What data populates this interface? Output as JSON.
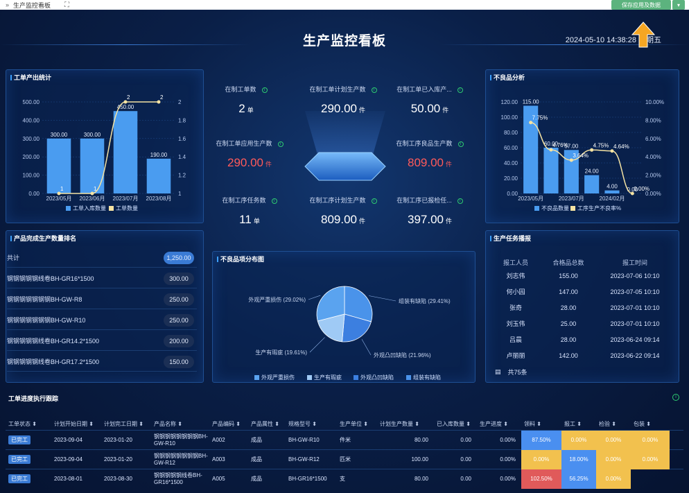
{
  "topbar": {
    "breadcrumb_sep": "»",
    "breadcrumb_title": "生产监控看板",
    "fullscreen_glyph": "⛶",
    "save_label": "保存应用及数据",
    "dropdown_glyph": "▾"
  },
  "header": {
    "title": "生产监控看板",
    "datetime": "2024-05-10 14:38:28 星期五"
  },
  "colors": {
    "bar": "#4a9cf0",
    "line": "#f5e3a3",
    "red": "#ff5a5a",
    "accent": "#3a7bd5"
  },
  "panels": {
    "workorder_output": "工单产出统计",
    "defect_analysis": "不良品分析",
    "product_rank": "产品完成生产数量排名",
    "defect_dist": "不良品项分布图",
    "task_ranking": "生产任务播报",
    "workorder_progress": "工单进度执行跟踪"
  },
  "kpis": [
    {
      "label": "在制工单数",
      "value": "2",
      "unit": "单",
      "red": false
    },
    {
      "label": "在制工单计划生产数",
      "value": "290.00",
      "unit": "件",
      "red": false
    },
    {
      "label": "在制工单已入库产...",
      "value": "50.00",
      "unit": "件",
      "red": false
    },
    {
      "label": "在制工单应用生产数",
      "value": "290.00",
      "unit": "件",
      "red": true
    },
    {
      "label": "在制工序良品生产数",
      "value": "809.00",
      "unit": "件",
      "red": true
    },
    {
      "label": "在制工序任务数",
      "value": "11",
      "unit": "单",
      "red": false
    },
    {
      "label": "在制工序计划生产数",
      "value": "809.00",
      "unit": "件",
      "red": false
    },
    {
      "label": "在制工序已报检任...",
      "value": "397.00",
      "unit": "件",
      "red": false
    }
  ],
  "chart_data": [
    {
      "type": "bar",
      "title": "工单产出统计",
      "categories": [
        "2023/05月",
        "2023/06月",
        "2023/07月",
        "2023/08月"
      ],
      "series": [
        {
          "name": "工单入库数量",
          "values": [
            300,
            300,
            450,
            190
          ]
        },
        {
          "name": "工单数量",
          "values": [
            1,
            1,
            2,
            2
          ]
        }
      ],
      "bar_labels": [
        "300.00",
        "300.00",
        "450.00",
        "190.00"
      ],
      "line_labels": [
        "1",
        "1",
        "2",
        "2"
      ],
      "ylim": [
        0,
        500
      ],
      "y2lim": [
        1,
        2
      ],
      "yticks": [
        "0.00",
        "100.00",
        "200.00",
        "300.00",
        "400.00",
        "500.00"
      ],
      "y2ticks": [
        "1",
        "1.2",
        "1.4",
        "1.6",
        "1.8",
        "2"
      ]
    },
    {
      "type": "bar",
      "title": "不良品分析",
      "categories": [
        "2023/05月",
        "2023/06月",
        "2023/07月",
        "2023/08月",
        "2024/02月",
        "2024/03月"
      ],
      "series": [
        {
          "name": "不良品数量",
          "values": [
            115,
            60,
            57,
            24,
            4,
            0
          ]
        },
        {
          "name": "工序生产不良率%",
          "values": [
            7.75,
            4.76,
            3.64,
            4.75,
            4.64,
            0
          ]
        }
      ],
      "bar_labels": [
        "115.00",
        "60.00",
        "57.00",
        "24.00",
        "4.00",
        "0.00"
      ],
      "line_labels": [
        "7.75%",
        "4.76%",
        "3.64%",
        "4.75%",
        "4.64%",
        "0.00%"
      ],
      "xtick_labels": [
        "2023/05月",
        "2023/07月",
        "2024/02月"
      ],
      "ylim": [
        0,
        120
      ],
      "y2lim": [
        0,
        10
      ],
      "yticks": [
        "0.00",
        "20.00",
        "40.00",
        "60.00",
        "80.00",
        "100.00",
        "120.00"
      ],
      "y2ticks": [
        "0.00%",
        "2.00%",
        "4.00%",
        "6.00%",
        "8.00%",
        "10.00%"
      ]
    },
    {
      "type": "pie",
      "title": "不良品项分布图",
      "labels": [
        "外观严重损伤",
        "生产有瑕疵",
        "外观凸凹缺陷",
        "组装有缺陷"
      ],
      "values": [
        29.02,
        19.61,
        21.96,
        29.41
      ],
      "slice_labels": [
        "外观严重损伤 (29.02%)",
        "生产有瑕疵 (19.61%)",
        "外观凸凹缺陷 (21.96%)",
        "组装有缺陷 (29.41%)"
      ],
      "colors": [
        "#5aa3ef",
        "#9fcaf5",
        "#3c7fe0",
        "#4a93ea"
      ]
    }
  ],
  "rank": {
    "total_label": "共计",
    "total_value": "1,250.00",
    "items": [
      {
        "name": "钢钢钢钢钢线卷BH-GR16*1500",
        "value": "300.00"
      },
      {
        "name": "钢钢钢钢钢钢钢BH-GW-R8",
        "value": "250.00"
      },
      {
        "name": "钢钢钢钢钢钢钢BH-GW-R10",
        "value": "250.00"
      },
      {
        "name": "钢钢钢钢钢线卷BH-GR14.2*1500",
        "value": "200.00"
      },
      {
        "name": "钢钢钢钢钢线卷BH-GR17.2*1500",
        "value": "150.00"
      }
    ]
  },
  "task": {
    "headers": [
      "报工人员",
      "合格品总数",
      "报工时间"
    ],
    "rows": [
      [
        "刘志伟",
        "155.00",
        "2023-07-06 10:10"
      ],
      [
        "何小园",
        "147.00",
        "2023-07-05 10:10"
      ],
      [
        "张奇",
        "28.00",
        "2023-07-01 10:10"
      ],
      [
        "刘玉伟",
        "25.00",
        "2023-07-01 10:10"
      ],
      [
        "吕晨",
        "28.00",
        "2023-06-24 09:14"
      ],
      [
        "卢丽丽",
        "142.00",
        "2023-06-22 09:14"
      ]
    ],
    "footer": "共75条"
  },
  "progress": {
    "headers": [
      "工单状态",
      "计划开始日期",
      "计划完工日期",
      "产品名称",
      "产品编码",
      "产品属性",
      "规格型号",
      "生产单位",
      "计划生产数量",
      "已入库数量",
      "生产进度",
      "领料",
      "报工",
      "检验",
      "包装"
    ],
    "rows": [
      {
        "status": "已完工",
        "start": "2023-09-04",
        "end": "2023-01-20",
        "name": "钢钢钢钢钢钢钢钢BH-GW-R10",
        "code": "A002",
        "attr": "成品",
        "spec": "BH-GW-R10",
        "unit": "件米",
        "plan": "80.00",
        "stocked": "0.00",
        "progress": "0.00%",
        "p1": "87.50%",
        "p2": "0.00%",
        "p3": "0.00%",
        "p4": "0.00%"
      },
      {
        "status": "已完工",
        "start": "2023-09-04",
        "end": "2023-01-20",
        "name": "钢钢钢钢钢钢钢钢BH-GW-R12",
        "code": "A003",
        "attr": "成品",
        "spec": "BH-GW-R12",
        "unit": "匹米",
        "plan": "100.00",
        "stocked": "0.00",
        "progress": "0.00%",
        "p1": "0.00%",
        "p2": "18.00%",
        "p3": "0.00%",
        "p4": "0.00%"
      },
      {
        "status": "已完工",
        "start": "2023-08-01",
        "end": "2023-08-30",
        "name": "钢钢钢钢钢线卷BH-GR16*1500",
        "code": "A005",
        "attr": "成品",
        "spec": "BH-GR16*1500",
        "unit": "支",
        "plan": "80.00",
        "stocked": "0.00",
        "progress": "0.00%",
        "p1": "102.50%",
        "p2": "56.25%",
        "p3": "0.00%",
        "p4": ""
      }
    ]
  },
  "icons": {
    "info": "i",
    "sort": "⬍",
    "list": "▤"
  }
}
